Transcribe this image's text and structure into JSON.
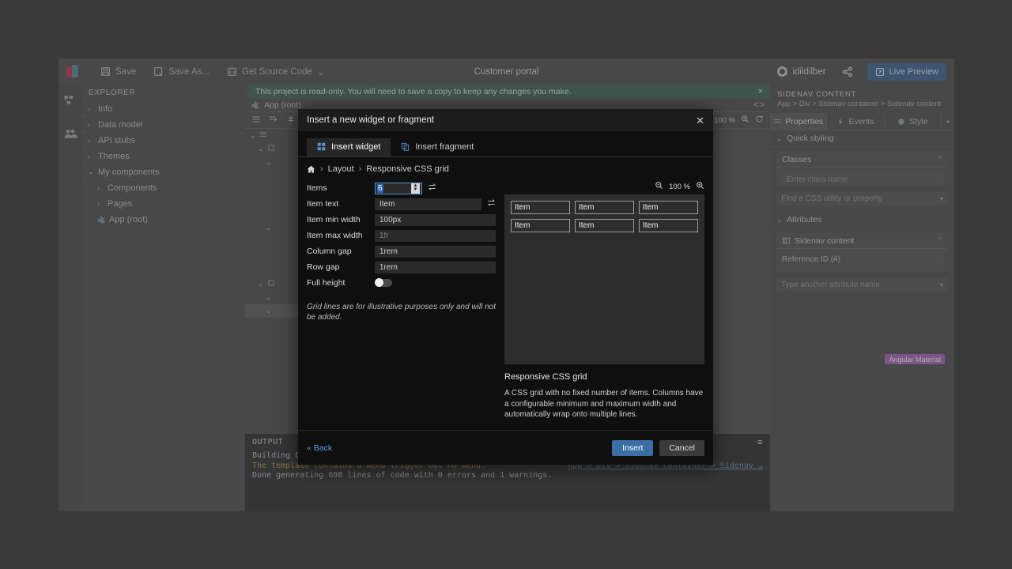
{
  "toolbar": {
    "save_label": "Save",
    "save_as_label": "Save As...",
    "get_source_label": "Get Source Code",
    "dropdown_caret": "⌄",
    "project_title": "Customer portal",
    "user_name": "idildilber",
    "live_preview_label": "Live Preview"
  },
  "banner": {
    "message": "This project is read-only. You will need to save a copy to keep any changes you make.",
    "close": "×"
  },
  "explorer": {
    "header": "EXPLORER",
    "items": [
      {
        "label": "Info",
        "chevron": "›",
        "indent": false
      },
      {
        "label": "Data model",
        "chevron": "›",
        "indent": false
      },
      {
        "label": "API stubs",
        "chevron": "›",
        "indent": false
      },
      {
        "label": "Themes",
        "chevron": "›",
        "indent": false
      },
      {
        "label": "My components",
        "chevron": "⌄",
        "indent": false
      },
      {
        "label": "Components",
        "chevron": "›",
        "indent": true
      },
      {
        "label": "Pages",
        "chevron": "›",
        "indent": true
      },
      {
        "label": "App (root)",
        "chevron": "",
        "indent": true
      }
    ]
  },
  "editor": {
    "tab_label": "App (root)",
    "zoom_level": "100 %"
  },
  "output": {
    "header": "OUTPUT",
    "lines": [
      {
        "text": "Building Customer portal...",
        "type": "normal"
      },
      {
        "text": "The template contains a menu trigger but no menu.",
        "type": "warn",
        "link": "App > Div > Sidenav container > Sidenav …"
      },
      {
        "text": "Done generating 698 lines of code with 0 errors and 1 warnings.",
        "type": "normal"
      }
    ]
  },
  "right_panel": {
    "title": "SIDENAV CONTENT",
    "breadcrumb": "App > Div > Sidenav container > Sidenav content",
    "tabs": [
      {
        "label": "Properties",
        "active": true
      },
      {
        "label": "Events",
        "active": false
      },
      {
        "label": "Style",
        "active": false
      }
    ],
    "more": "•",
    "quick_styling_label": "Quick styling",
    "classes_label": "Classes",
    "class_input_placeholder": "Enter class name",
    "css_util_placeholder": "Find a CSS utility or property",
    "attributes_label": "Attributes",
    "attr_card_title": "Sidenav content",
    "reference_id_label": "Reference ID (#)",
    "another_attr_placeholder": "Type another attribute name",
    "badge_label": "Angular Material"
  },
  "dialog": {
    "title": "Insert a new widget or fragment",
    "close": "✕",
    "tabs": [
      {
        "label": "Insert widget",
        "active": true
      },
      {
        "label": "Insert fragment",
        "active": false
      }
    ],
    "breadcrumb": {
      "home_icon": "home-icon",
      "sep": "›",
      "category": "Layout",
      "current": "Responsive CSS grid"
    },
    "form": [
      {
        "label": "Items",
        "value": "6",
        "type": "number",
        "placeholder": "",
        "swap": true
      },
      {
        "label": "Item text",
        "value": "Item",
        "type": "text",
        "placeholder": "",
        "swap": true
      },
      {
        "label": "Item min width",
        "value": "100px",
        "type": "text",
        "placeholder": "",
        "swap": false
      },
      {
        "label": "Item max width",
        "value": "",
        "type": "text",
        "placeholder": "1fr",
        "swap": false
      },
      {
        "label": "Column gap",
        "value": "1rem",
        "type": "text",
        "placeholder": "",
        "swap": false
      },
      {
        "label": "Row gap",
        "value": "1rem",
        "type": "text",
        "placeholder": "",
        "swap": false
      },
      {
        "label": "Full height",
        "value": "off",
        "type": "toggle",
        "placeholder": "",
        "swap": false
      }
    ],
    "hint": "Grid lines are for illustrative purposes only and will not be added.",
    "preview": {
      "zoom_level": "100 %",
      "items": [
        "Item",
        "Item",
        "Item",
        "Item",
        "Item",
        "Item"
      ],
      "title": "Responsive CSS grid",
      "description": "A CSS grid with no fixed number of items. Columns have a configurable minimum and maximum width and automatically wrap onto multiple lines."
    },
    "footer": {
      "back_label": "« Back",
      "insert_label": "Insert",
      "cancel_label": "Cancel"
    }
  }
}
